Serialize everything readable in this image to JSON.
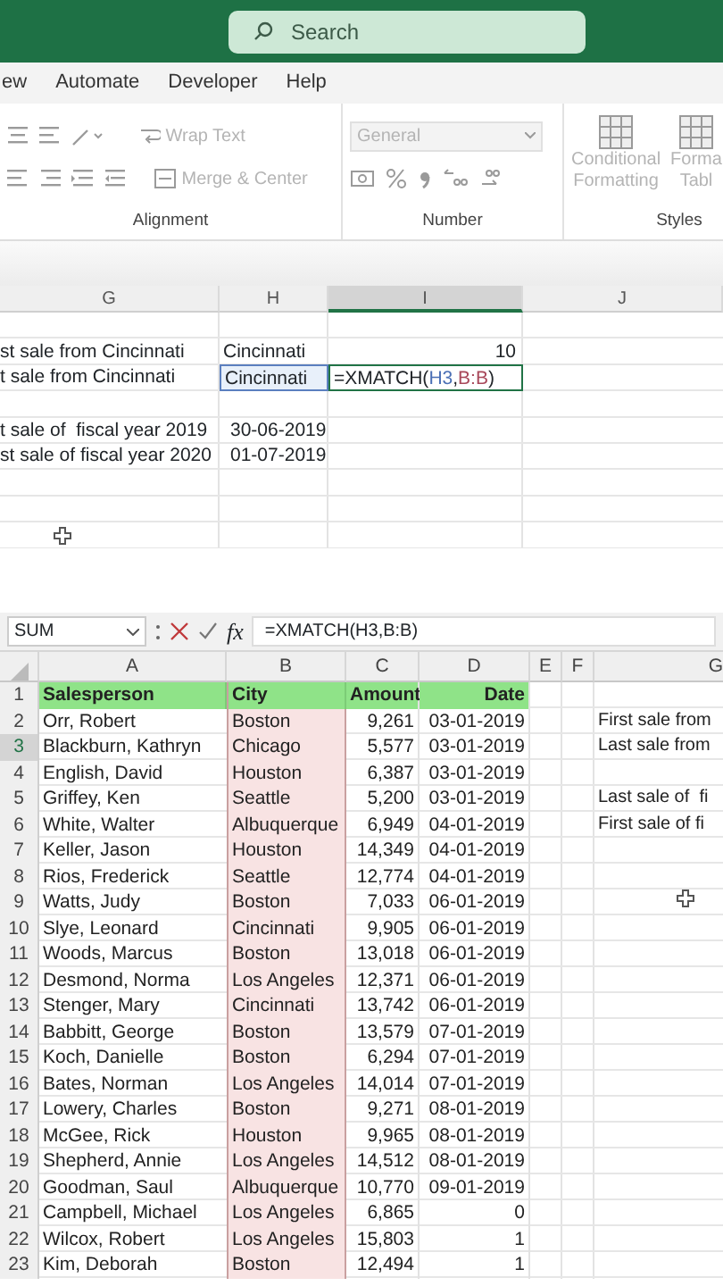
{
  "title_bar": {
    "search_placeholder": "Search"
  },
  "ribbon_tabs": [
    {
      "label": "ew"
    },
    {
      "label": "Automate"
    },
    {
      "label": "Developer"
    },
    {
      "label": "Help"
    }
  ],
  "ribbon": {
    "disabled": true,
    "alignment": {
      "wrap_text": "Wrap Text",
      "merge_center": "Merge & Center",
      "label": "Alignment"
    },
    "number": {
      "format": "General",
      "label": "Number"
    },
    "styles": {
      "conditional": [
        "Conditional",
        "Formatting"
      ],
      "format_table": [
        "Forma",
        "Tabl"
      ],
      "label": "Styles"
    }
  },
  "zoomed_sheet": {
    "columns": [
      {
        "label": "G",
        "selected": false
      },
      {
        "label": "H",
        "selected": false
      },
      {
        "label": "I",
        "selected": true
      },
      {
        "label": "J",
        "selected": false
      }
    ],
    "rows": [
      {},
      {
        "g": "st sale from Cincinnati",
        "h": "Cincinnati",
        "h_highlighted": false,
        "i": "10"
      },
      {
        "g": "t sale from Cincinnati",
        "h": "Cincinnati",
        "h_highlighted": true,
        "formula": [
          {
            "text": "=XMATCH("
          },
          {
            "text": "H3",
            "color": "#4a6fb5"
          },
          {
            "text": ","
          },
          {
            "text": "B:B",
            "color": "#a8485a"
          },
          {
            "text": ")"
          }
        ]
      },
      {},
      {
        "g": "t sale of  fiscal year 2019",
        "h": "30-06-2019",
        "h_highlighted": false
      },
      {
        "g": "st sale of fiscal year 2020",
        "h": "01-07-2019",
        "h_highlighted": false
      },
      {},
      {},
      {}
    ]
  },
  "formula_bar": {
    "name_box": "SUM",
    "function_label": "fx",
    "formula": "=XMATCH(H3,B:B)"
  },
  "sheet": {
    "columns": [
      "A",
      "B",
      "C",
      "D",
      "E",
      "F",
      "G"
    ],
    "rows": [
      {
        "kind": "header",
        "number": "1",
        "active": false,
        "name": "Salesperson",
        "city": "City",
        "amount": "Amount",
        "date": "Date"
      },
      {
        "kind": "data",
        "number": "2",
        "active": false,
        "name": "Orr, Robert",
        "city": "Boston",
        "amount": "9,261",
        "date": "03-01-2019",
        "note": "First sale from"
      },
      {
        "kind": "data",
        "number": "3",
        "active": true,
        "name": "Blackburn, Kathryn",
        "city": "Chicago",
        "amount": "5,577",
        "date": "03-01-2019",
        "note": "Last sale from"
      },
      {
        "kind": "data",
        "number": "4",
        "active": false,
        "name": "English, David",
        "city": "Houston",
        "amount": "6,387",
        "date": "03-01-2019"
      },
      {
        "kind": "data",
        "number": "5",
        "active": false,
        "name": "Griffey, Ken",
        "city": "Seattle",
        "amount": "5,200",
        "date": "03-01-2019",
        "note": "Last sale of  fi"
      },
      {
        "kind": "data",
        "number": "6",
        "active": false,
        "name": "White, Walter",
        "city": "Albuquerque",
        "amount": "6,949",
        "date": "04-01-2019",
        "note": "First sale of fi"
      },
      {
        "kind": "data",
        "number": "7",
        "active": false,
        "name": "Keller, Jason",
        "city": "Houston",
        "amount": "14,349",
        "date": "04-01-2019"
      },
      {
        "kind": "data",
        "number": "8",
        "active": false,
        "name": "Rios, Frederick",
        "city": "Seattle",
        "amount": "12,774",
        "date": "04-01-2019"
      },
      {
        "kind": "data",
        "number": "9",
        "active": false,
        "name": "Watts, Judy",
        "city": "Boston",
        "amount": "7,033",
        "date": "06-01-2019"
      },
      {
        "kind": "data",
        "number": "10",
        "active": false,
        "name": "Slye, Leonard",
        "city": "Cincinnati",
        "amount": "9,905",
        "date": "06-01-2019"
      },
      {
        "kind": "data",
        "number": "11",
        "active": false,
        "name": "Woods, Marcus",
        "city": "Boston",
        "amount": "13,018",
        "date": "06-01-2019"
      },
      {
        "kind": "data",
        "number": "12",
        "active": false,
        "name": "Desmond, Norma",
        "city": "Los Angeles",
        "amount": "12,371",
        "date": "06-01-2019"
      },
      {
        "kind": "data",
        "number": "13",
        "active": false,
        "name": "Stenger, Mary",
        "city": "Cincinnati",
        "amount": "13,742",
        "date": "06-01-2019"
      },
      {
        "kind": "data",
        "number": "14",
        "active": false,
        "name": "Babbitt, George",
        "city": "Boston",
        "amount": "13,579",
        "date": "07-01-2019"
      },
      {
        "kind": "data",
        "number": "15",
        "active": false,
        "name": "Koch, Danielle",
        "city": "Boston",
        "amount": "6,294",
        "date": "07-01-2019"
      },
      {
        "kind": "data",
        "number": "16",
        "active": false,
        "name": "Bates, Norman",
        "city": "Los Angeles",
        "amount": "14,014",
        "date": "07-01-2019"
      },
      {
        "kind": "data",
        "number": "17",
        "active": false,
        "name": "Lowery, Charles",
        "city": "Boston",
        "amount": "9,271",
        "date": "08-01-2019"
      },
      {
        "kind": "data",
        "number": "18",
        "active": false,
        "name": "McGee, Rick",
        "city": "Houston",
        "amount": "9,965",
        "date": "08-01-2019"
      },
      {
        "kind": "data",
        "number": "19",
        "active": false,
        "name": "Shepherd, Annie",
        "city": "Los Angeles",
        "amount": "14,512",
        "date": "08-01-2019"
      },
      {
        "kind": "data",
        "number": "20",
        "active": false,
        "name": "Goodman, Saul",
        "city": "Albuquerque",
        "amount": "10,770",
        "date": "09-01-2019"
      },
      {
        "kind": "data",
        "number": "21",
        "active": false,
        "name": "Campbell, Michael",
        "city": "Los Angeles",
        "amount": "6,865",
        "date": "0"
      },
      {
        "kind": "data",
        "number": "22",
        "active": false,
        "name": "Wilcox, Robert",
        "city": "Los Angeles",
        "amount": "15,803",
        "date": "1"
      },
      {
        "kind": "data",
        "number": "23",
        "active": false,
        "name": "Kim, Deborah",
        "city": "Boston",
        "amount": "12,494",
        "date": "1"
      }
    ]
  }
}
